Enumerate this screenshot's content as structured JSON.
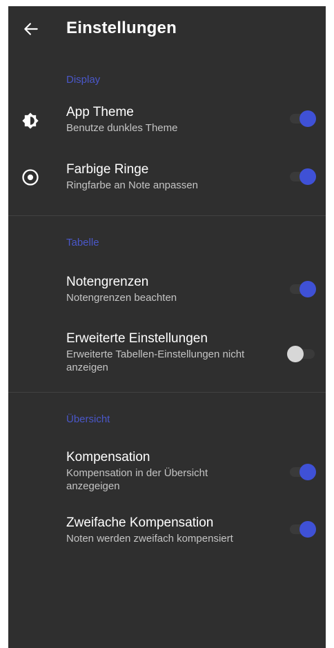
{
  "app_bar": {
    "back_icon": "arrow-left-icon",
    "title": "Einstellungen"
  },
  "sections": [
    {
      "title": "Display",
      "items": [
        {
          "title": "App Theme",
          "subtitle": "Benutze dunkles Theme",
          "icon": "brightness-icon",
          "enabled": true
        },
        {
          "title": "Farbige Ringe",
          "subtitle": "Ringfarbe an Note anpassen",
          "icon": "radio-target-icon",
          "enabled": true
        }
      ]
    },
    {
      "title": "Tabelle",
      "items": [
        {
          "title": "Notengrenzen",
          "subtitle": "Notengrenzen beachten",
          "enabled": true
        },
        {
          "title": "Erweiterte Einstellungen",
          "subtitle": "Erweiterte Tabellen-Einstellungen nicht anzeigen",
          "enabled": false
        }
      ]
    },
    {
      "title": "Übersicht",
      "items": [
        {
          "title": "Kompensation",
          "subtitle": "Kompensation in der Übersicht anzegeigen",
          "enabled": true
        },
        {
          "title": "Zweifache Kompensation",
          "subtitle": "Noten werden zweifach kompensiert",
          "enabled": true
        }
      ]
    }
  ],
  "colors": {
    "background": "#2f2f2f",
    "accent": "#3f51d6",
    "section_title": "#4a57c9",
    "switch_off_thumb": "#d7d7d7",
    "text_primary": "#ffffff",
    "text_secondary": "#c4c4c4"
  }
}
